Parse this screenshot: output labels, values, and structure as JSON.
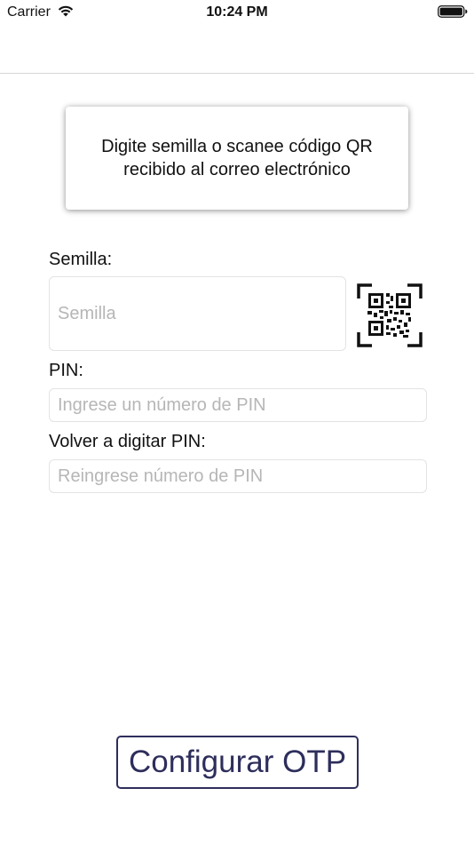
{
  "status_bar": {
    "carrier": "Carrier",
    "time": "10:24 PM",
    "wifi_icon": "wifi-icon",
    "battery_icon": "battery-icon"
  },
  "info_card": {
    "message": "Digite semilla o scanee código QR recibido al correo electrónico"
  },
  "form": {
    "seed_label": "Semilla:",
    "seed_placeholder": "Semilla",
    "seed_value": "",
    "qr_icon": "qr-code-scan-icon",
    "pin_label": "PIN:",
    "pin_placeholder": "Ingrese un número de PIN",
    "pin_value": "",
    "pin_confirm_label": "Volver a digitar PIN:",
    "pin_confirm_placeholder": "Reingrese número de PIN",
    "pin_confirm_value": ""
  },
  "actions": {
    "configure_label": "Configurar OTP"
  },
  "colors": {
    "button_accent": "#2e2e5c",
    "placeholder": "#b6b6b8",
    "field_border": "#e3e3e3"
  }
}
